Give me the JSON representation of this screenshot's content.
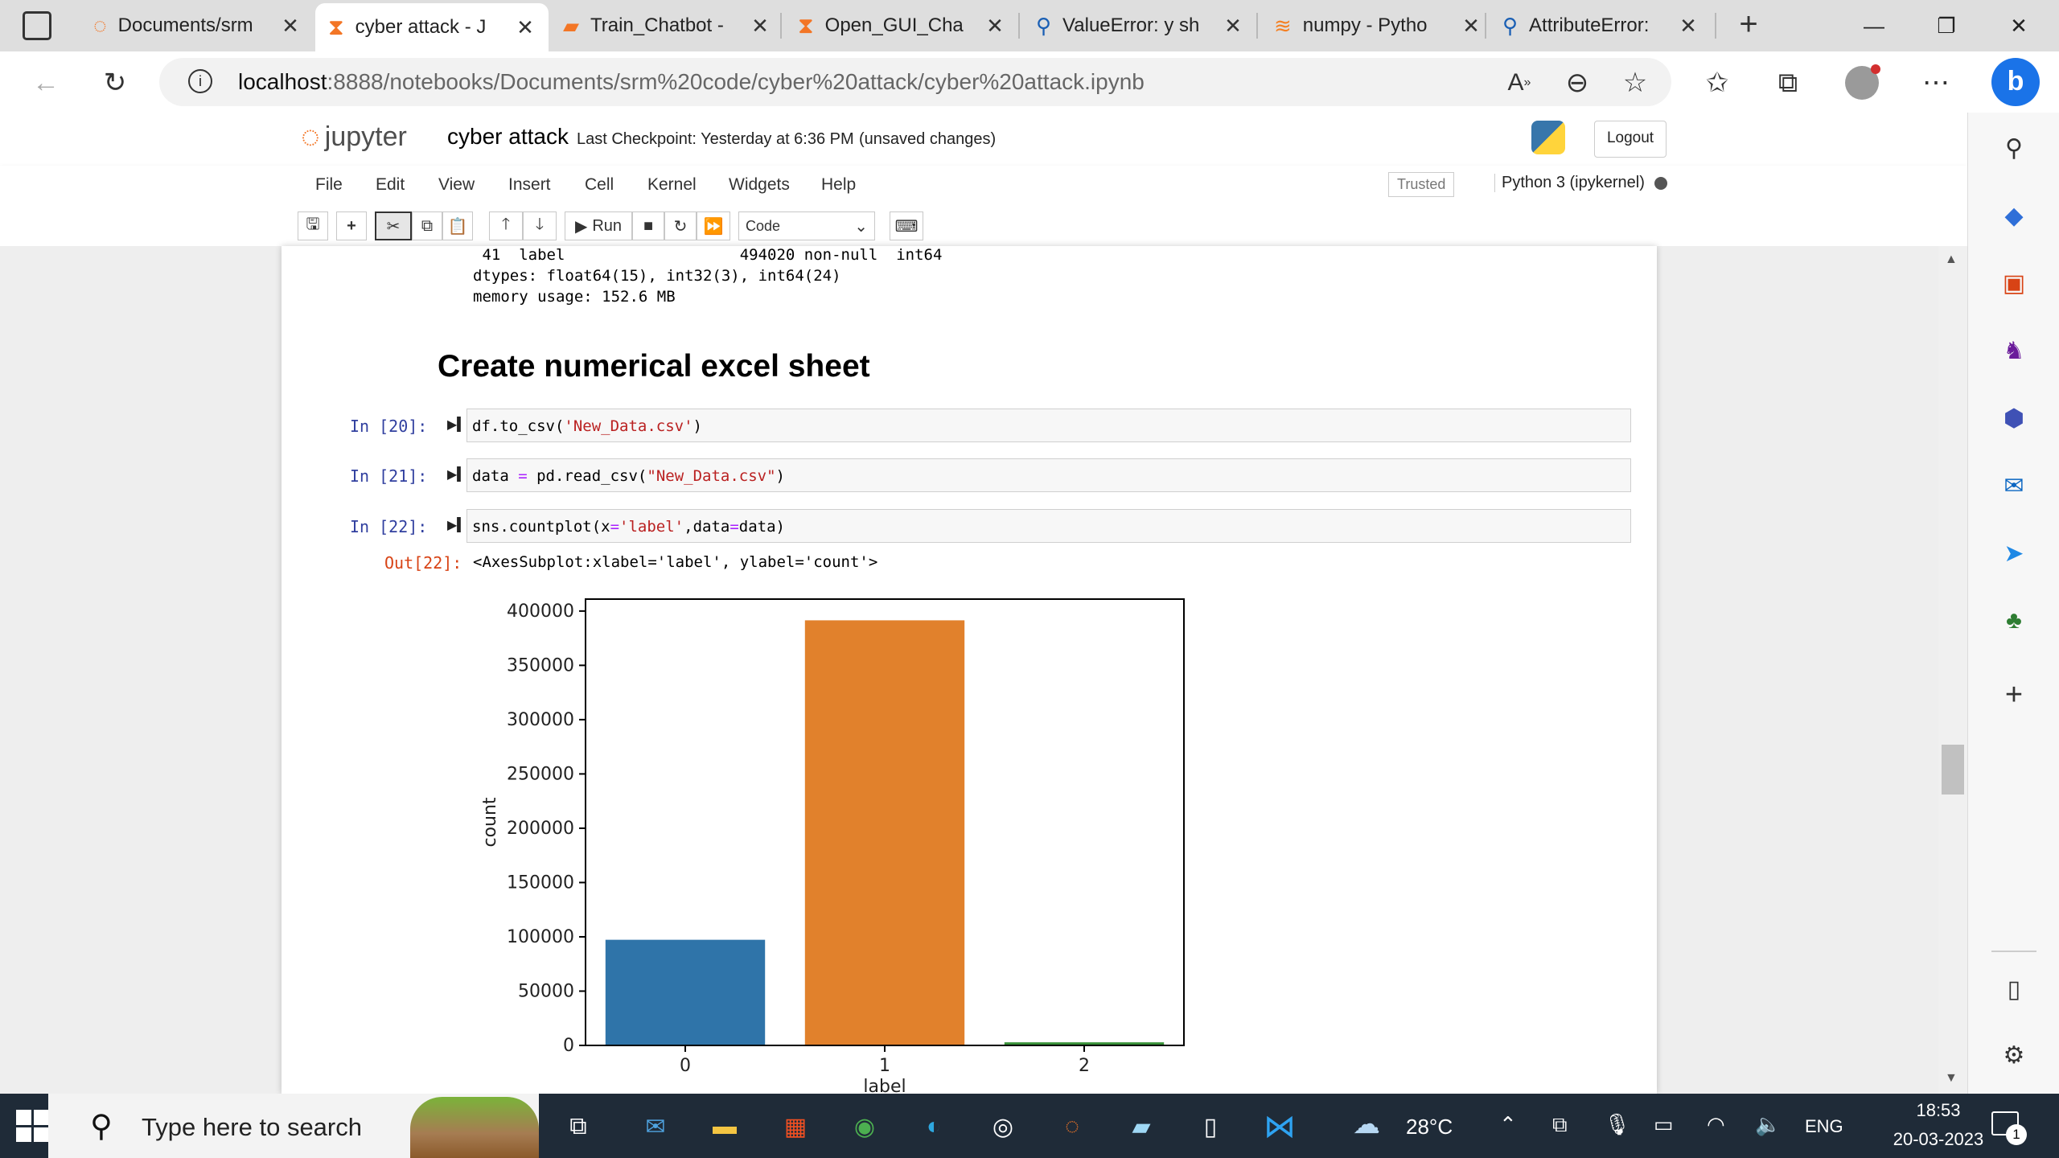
{
  "browser": {
    "tabs": [
      {
        "label": "Documents/srm",
        "icon": "jupyter-icon"
      },
      {
        "label": "cyber attack - J",
        "icon": "jupyter-hourglass-icon",
        "active": true
      },
      {
        "label": "Train_Chatbot -",
        "icon": "notebook-icon"
      },
      {
        "label": "Open_GUI_Cha",
        "icon": "jupyter-hourglass-icon"
      },
      {
        "label": "ValueError: y sh",
        "icon": "search-icon"
      },
      {
        "label": "numpy - Pytho",
        "icon": "stackoverflow-icon"
      },
      {
        "label": "AttributeError:",
        "icon": "search-icon"
      }
    ],
    "url_host": "localhost",
    "url_rest": ":8888/notebooks/Documents/srm%20code/cyber%20attack/cyber%20attack.ipynb"
  },
  "jupyter": {
    "logo_text": "jupyter",
    "notebook_name": "cyber attack",
    "checkpoint": "Last Checkpoint: Yesterday at 6:36 PM",
    "unsaved": "(unsaved changes)",
    "logout": "Logout",
    "menu": [
      "File",
      "Edit",
      "View",
      "Insert",
      "Cell",
      "Kernel",
      "Widgets",
      "Help"
    ],
    "trusted": "Trusted",
    "kernel": "Python 3 (ipykernel)",
    "run_label": "Run",
    "cell_type": "Code"
  },
  "notebook": {
    "info_line1": " 41  label                   494020 non-null  int64",
    "info_line2": "dtypes: float64(15), int32(3), int64(24)",
    "info_line3": "memory usage: 152.6 MB",
    "heading": "Create numerical excel sheet",
    "cells": [
      {
        "prompt": "In [20]:",
        "code_a": "df.to_csv(",
        "code_str": "'New_Data.csv'",
        "code_b": ")"
      },
      {
        "prompt": "In [21]:",
        "code_a": "data ",
        "code_op": "=",
        "code_c": " pd.read_csv(",
        "code_str": "\"New_Data.csv\"",
        "code_b": ")"
      },
      {
        "prompt": "In [22]:",
        "code_a": "sns.countplot(x",
        "code_op": "=",
        "code_str": "'label'",
        "code_c": ",data",
        "code_op2": "=",
        "code_b": "data)"
      }
    ],
    "out_prompt": "Out[22]:",
    "out_text": "<AxesSubplot:xlabel='label', ylabel='count'>"
  },
  "chart_data": {
    "type": "bar",
    "categories": [
      "0",
      "1",
      "2"
    ],
    "values": [
      97278,
      391458,
      2870
    ],
    "colors": [
      "#2f74a9",
      "#e1812c",
      "#3a923a"
    ],
    "xlabel": "label",
    "ylabel": "count",
    "ylim": [
      0,
      411000
    ],
    "yticks": [
      0,
      50000,
      100000,
      150000,
      200000,
      250000,
      300000,
      350000,
      400000
    ]
  },
  "taskbar": {
    "search_placeholder": "Type here to search",
    "weather": "28°C",
    "lang": "ENG",
    "time": "18:53",
    "date": "20-03-2023",
    "notifications": "1"
  }
}
